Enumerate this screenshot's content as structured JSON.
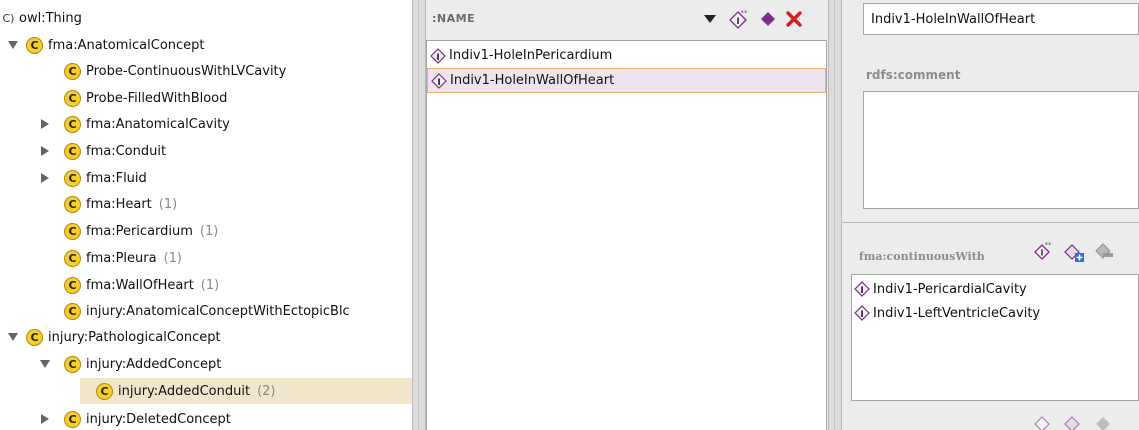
{
  "colors": {
    "class_icon": "#f3ce2e",
    "selected_row": "#f1e6cc",
    "selected_instance": "#eee3ee",
    "delete_red": "#d22020",
    "diamond_purple": "#7a2e8a"
  },
  "tree": {
    "items": [
      {
        "label": "owl:Thing",
        "icon": "class-icon",
        "toggle": "none"
      },
      {
        "label": "fma:AnatomicalConcept",
        "icon": "class-icon",
        "toggle": "expanded"
      },
      {
        "label": "Probe-ContinuousWithLVCavity",
        "icon": "class-icon",
        "toggle": "none"
      },
      {
        "label": "Probe-FilledWithBlood",
        "icon": "class-icon",
        "toggle": "none"
      },
      {
        "label": "fma:AnatomicalCavity",
        "icon": "class-icon",
        "toggle": "collapsed"
      },
      {
        "label": "fma:Conduit",
        "icon": "class-icon",
        "toggle": "collapsed"
      },
      {
        "label": "fma:Fluid",
        "icon": "class-icon",
        "toggle": "collapsed"
      },
      {
        "label": "fma:Heart",
        "count": "(1)",
        "icon": "class-icon",
        "toggle": "none"
      },
      {
        "label": "fma:Pericardium",
        "count": "(1)",
        "icon": "class-icon",
        "toggle": "none"
      },
      {
        "label": "fma:Pleura",
        "count": "(1)",
        "icon": "class-icon",
        "toggle": "none"
      },
      {
        "label": "fma:WallOfHeart",
        "count": "(1)",
        "icon": "class-icon",
        "toggle": "none"
      },
      {
        "label": "injury:AnatomicalConceptWithEctopicBlc",
        "icon": "class-icon",
        "toggle": "none"
      },
      {
        "label": "injury:PathologicalConcept",
        "icon": "class-icon",
        "toggle": "expanded"
      },
      {
        "label": "injury:AddedConcept",
        "icon": "class-icon",
        "toggle": "expanded"
      },
      {
        "label": "injury:AddedConduit",
        "count": "(2)",
        "icon": "class-icon",
        "toggle": "none",
        "selected": true
      },
      {
        "label": "injury:DeletedConcept",
        "icon": "class-icon",
        "toggle": "collapsed"
      }
    ]
  },
  "instances": {
    "header_label": ":NAME",
    "toolbar_icons": [
      "dropdown-arrow-icon",
      "create-instance-icon",
      "diamond-icon",
      "delete-icon"
    ],
    "items": [
      {
        "label": "Indiv1-HoleInPericardium",
        "icon": "instance-icon"
      },
      {
        "label": "Indiv1-HoleInWallOfHeart",
        "icon": "instance-icon",
        "selected": true
      }
    ]
  },
  "form": {
    "name_value": "Indiv1-HoleInWallOfHeart",
    "comment_label": "rdfs:comment",
    "comment_value": "",
    "continuous_label": "fma:continuousWith",
    "continuous_icons": [
      "create-instance-icon",
      "add-value-icon",
      "remove-value-icon"
    ],
    "continuous_items": [
      {
        "label": "Indiv1-PericardialCavity",
        "icon": "instance-icon"
      },
      {
        "label": "Indiv1-LeftVentricleCavity",
        "icon": "instance-icon"
      }
    ]
  }
}
